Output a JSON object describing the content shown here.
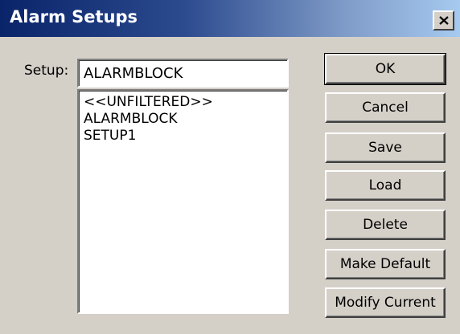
{
  "window": {
    "title": "Alarm Setups",
    "close_icon": "close-icon"
  },
  "form": {
    "setup_label": "Setup:",
    "setup_value": "ALARMBLOCK"
  },
  "setups_list": {
    "items": [
      "<<UNFILTERED>>",
      "ALARMBLOCK",
      "SETUP1"
    ]
  },
  "buttons": {
    "ok": "OK",
    "cancel": "Cancel",
    "save": "Save",
    "load": "Load",
    "delete": "Delete",
    "make_default": "Make Default",
    "modify_current": "Modify Current"
  },
  "colors": {
    "title_start": "#0a246a",
    "title_end": "#a6caf0",
    "face": "#d4d0c8"
  }
}
